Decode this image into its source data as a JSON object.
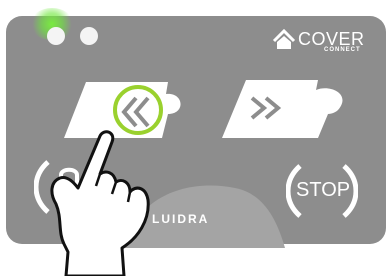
{
  "brand": {
    "name": "COVER",
    "subtitle": "CONNECT",
    "maker": "LUIDRA",
    "logo_icon": "house-roof-icon"
  },
  "buttons": {
    "open": {
      "icon": "double-chevron-left-icon",
      "state": "pressed"
    },
    "close": {
      "icon": "double-chevron-right-icon"
    },
    "lock": {
      "icon": "padlock-icon"
    },
    "stop": {
      "label": "STOP"
    }
  },
  "indicators": {
    "led_left": "green-glow",
    "led_right": "white"
  },
  "colors": {
    "panel": "#8d8d8d",
    "highlight_ring": "#9ad12e",
    "led_glow": "#6fe03c"
  }
}
